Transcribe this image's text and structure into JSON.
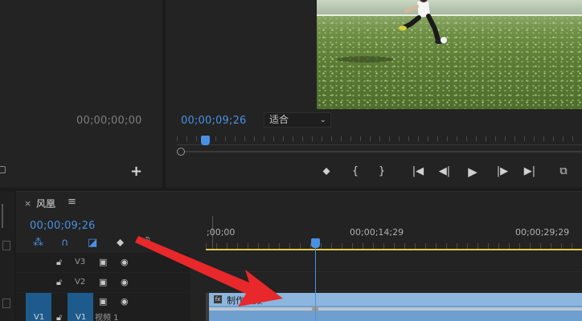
{
  "source_monitor": {
    "timecode": "00;00;00;00",
    "add_label": "+"
  },
  "program_monitor": {
    "timecode": "00;00;09;26",
    "fit_value": "适合",
    "transport": {
      "marker": "⬥",
      "mark_in": "{",
      "mark_out": "}",
      "go_to_in": "|◀",
      "step_back": "◀|",
      "play": "▶",
      "step_forward": "|▶",
      "go_to_out": "▶|",
      "export_frame": "⧉"
    }
  },
  "timeline": {
    "close": "×",
    "title": "风凰",
    "menu": "≡",
    "timecode": "00;00;09;26",
    "ruler_labels": [
      ";00;00",
      "00;00;14;29",
      "00;00;29;29"
    ],
    "tracks": [
      {
        "name": "V3",
        "lock": "🔓︎",
        "cam": "▣",
        "eye": "◉"
      },
      {
        "name": "V2",
        "lock": "🔓︎",
        "cam": "▣",
        "eye": "◉"
      },
      {
        "name": "V1",
        "lock": "🔓︎",
        "cam": "▣",
        "eye": "◉"
      }
    ],
    "v1_source": "V1",
    "v1_target": "V1",
    "v1_label": "视频 1",
    "clip": {
      "fx": "fx",
      "name": "制作视频"
    }
  },
  "colors": {
    "accent_blue": "#4a90e2",
    "clip_blue": "#6e9fce",
    "annotation_red": "#e8282b",
    "work_area_yellow": "#e3c94a"
  }
}
